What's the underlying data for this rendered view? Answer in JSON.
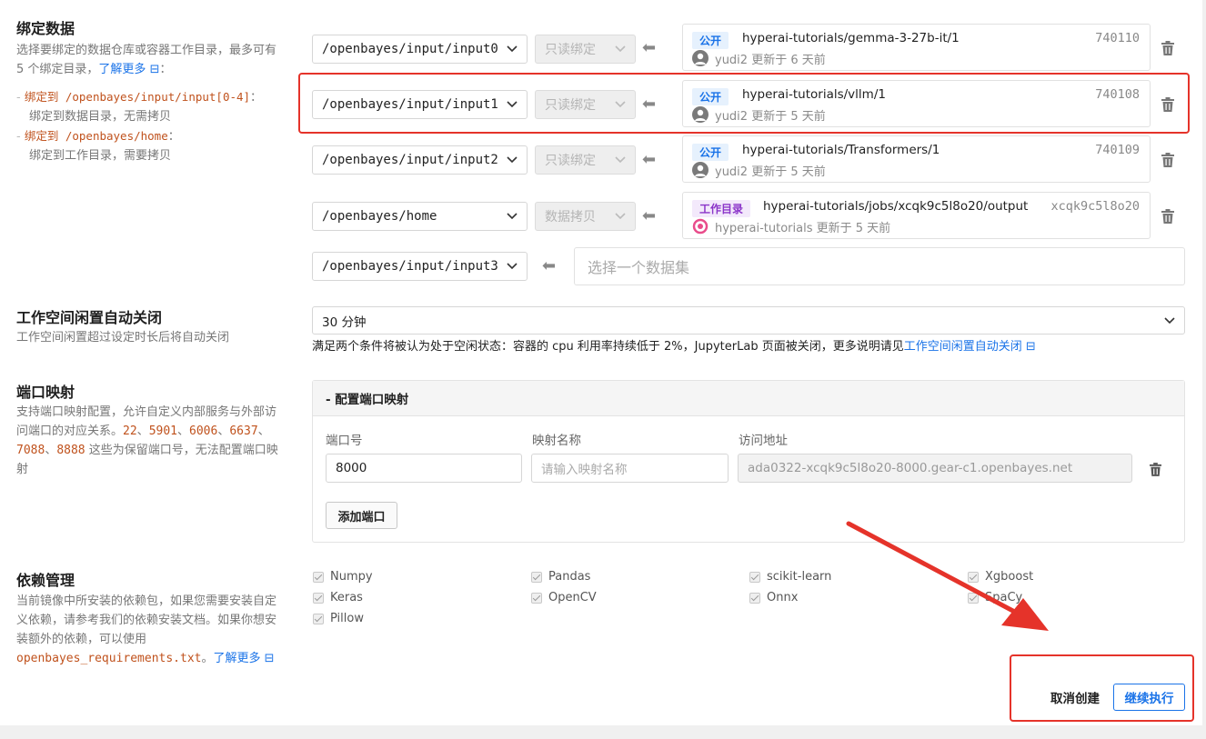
{
  "binding": {
    "title": "绑定数据",
    "desc_line1": "选择要绑定的数据仓库或容器工作目录，最多可有",
    "desc_line2": "5 个绑定目录，",
    "learn_more": "了解更多",
    "desc_colon": "：",
    "rule1_label": "绑定到 /openbayes/input/input[0-4]",
    "rule1_colon": "：",
    "rule1_desc": "绑定到数据目录，无需拷贝",
    "rule2_label": "绑定到 /openbayes/home",
    "rule2_colon": "：",
    "rule2_desc": "绑定到工作目录，需要拷贝",
    "rows": [
      {
        "path": "/openbayes/input/input0",
        "mode": "只读绑定",
        "badge": "公开",
        "badge_type": "pub",
        "name": "hyperai-tutorials/gemma-3-27b-it/1",
        "id": "740110",
        "user": "yudi2",
        "updated": "更新于 6 天前"
      },
      {
        "path": "/openbayes/input/input1",
        "mode": "只读绑定",
        "badge": "公开",
        "badge_type": "pub",
        "name": "hyperai-tutorials/vllm/1",
        "id": "740108",
        "user": "yudi2",
        "updated": "更新于 5 天前"
      },
      {
        "path": "/openbayes/input/input2",
        "mode": "只读绑定",
        "badge": "公开",
        "badge_type": "pub",
        "name": "hyperai-tutorials/Transformers/1",
        "id": "740109",
        "user": "yudi2",
        "updated": "更新于 5 天前"
      },
      {
        "path": "/openbayes/home",
        "mode": "数据拷贝",
        "badge": "工作目录",
        "badge_type": "work",
        "name": "hyperai-tutorials/jobs/xcqk9c5l8o20/output",
        "id": "xcqk9c5l8o20",
        "user": "hyperai-tutorials",
        "updated": "更新于 5 天前"
      }
    ],
    "empty_row": {
      "path": "/openbayes/input/input3",
      "placeholder": "选择一个数据集"
    }
  },
  "idle": {
    "title": "工作空间闲置自动关闭",
    "desc": "工作空间闲置超过设定时长后将自动关闭",
    "value": "30 分钟",
    "note": "满足两个条件将被认为处于空闲状态：容器的 cpu 利用率持续低于 2%，JupyterLab 页面被关闭，更多说明请见",
    "note_link": "工作空间闲置自动关闭"
  },
  "ports": {
    "title": "端口映射",
    "desc_a": "支持端口映射配置，允许自定义内部服务与外部访",
    "desc_b": "问端口的对应关系。",
    "reserved1": "22",
    "reserved2": "5901",
    "reserved3": "6006",
    "reserved4": "6637",
    "reserved5": "7088",
    "reserved6": "8888",
    "sep": "、",
    "desc_c": " 这些为保留端口号，无法配置端口映",
    "desc_d": "射",
    "panel_title": "- 配置端口映射",
    "col_port": "端口号",
    "col_name": "映射名称",
    "col_addr": "访问地址",
    "port_value": "8000",
    "name_placeholder": "请输入映射名称",
    "addr_value": "ada0322-xcqk9c5l8o20-8000.gear-c1.openbayes.net",
    "add_label": "添加端口"
  },
  "deps": {
    "title": "依赖管理",
    "desc1": "当前镜像中所安装的依赖包，如果您需要安装自定",
    "desc2": "义依赖，请参考我们的依赖安装文档。如果你想安",
    "desc3": "装额外的依赖，可以使用",
    "file": "openbayes_requirements.txt",
    "desc4": "。",
    "learn_more": "了解更多",
    "items": [
      "Numpy",
      "Pandas",
      "scikit-learn",
      "Xgboost",
      "Keras",
      "OpenCV",
      "Onnx",
      "SpaCy",
      "Pillow"
    ]
  },
  "actions": {
    "cancel": "取消创建",
    "continue": "继续执行"
  },
  "colors": {
    "accent": "#1a73e8",
    "annotation": "#e5332a",
    "reserved": "#c0521d"
  }
}
